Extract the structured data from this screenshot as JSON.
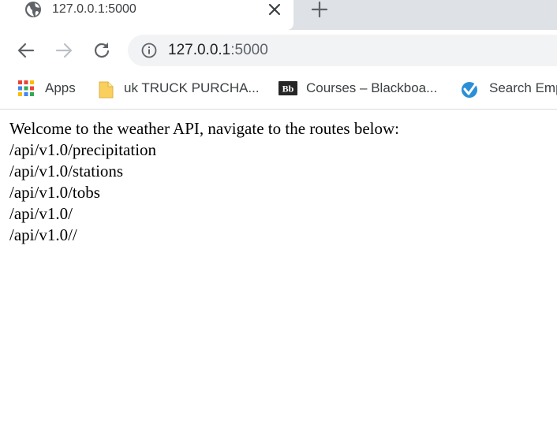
{
  "tab": {
    "title": "127.0.0.1:5000"
  },
  "omnibox": {
    "host": "127.0.0.1",
    "port": ":5000"
  },
  "bookmarks": [
    {
      "label": "Apps",
      "icon": "apps-grid-icon"
    },
    {
      "label": "uk TRUCK PURCHA...",
      "icon": "folder-icon"
    },
    {
      "label": "Courses – Blackboa...",
      "icon": "blackboard-icon"
    },
    {
      "label": "Search Emp",
      "icon": "checkmark-badge-icon"
    }
  ],
  "page": {
    "welcome": "Welcome to the weather API, navigate to the routes below:",
    "routes": [
      "/api/v1.0/precipitation",
      "/api/v1.0/stations",
      "/api/v1.0/tobs",
      "/api/v1.0/",
      "/api/v1.0//"
    ]
  },
  "colors": {
    "tabstrip_bg": "#dee1e6",
    "omnibox_bg": "#f1f3f4",
    "icon_gray": "#5f6368",
    "text": "#3c4043"
  }
}
